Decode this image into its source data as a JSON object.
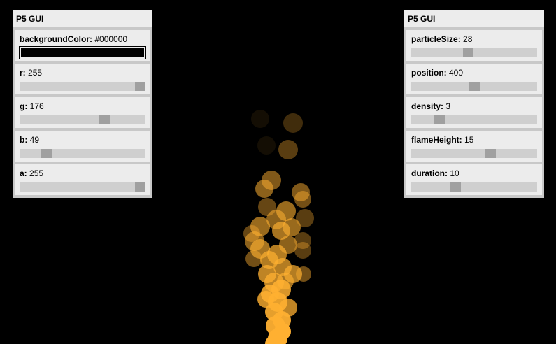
{
  "colors": {
    "canvas_bg": "#000000",
    "flame": "#ffb031",
    "panel_bg": "#ececec",
    "panel_border": "#c8c8c8",
    "track": "#cfcfcf",
    "handle": "#a0a0a0"
  },
  "left_panel": {
    "title": "P5 GUI",
    "background_color": {
      "label": "backgroundColor:",
      "value": "#000000",
      "swatch": "#000000"
    },
    "sliders": [
      {
        "key": "r",
        "label": "r:",
        "value": "255",
        "level": 1.0
      },
      {
        "key": "g",
        "label": "g:",
        "value": "176",
        "level": 0.69
      },
      {
        "key": "b",
        "label": "b:",
        "value": "49",
        "level": 0.19
      },
      {
        "key": "a",
        "label": "a:",
        "value": "255",
        "level": 1.0
      }
    ]
  },
  "right_panel": {
    "title": "P5 GUI",
    "sliders": [
      {
        "key": "particleSize",
        "label": "particleSize:",
        "value": "28",
        "level": 0.45
      },
      {
        "key": "position",
        "label": "position:",
        "value": "400",
        "level": 0.5
      },
      {
        "key": "density",
        "label": "density:",
        "value": "3",
        "level": 0.2
      },
      {
        "key": "flameHeight",
        "label": "flameHeight:",
        "value": "15",
        "level": 0.64
      },
      {
        "key": "duration",
        "label": "duration:",
        "value": "10",
        "level": 0.34
      }
    ]
  }
}
